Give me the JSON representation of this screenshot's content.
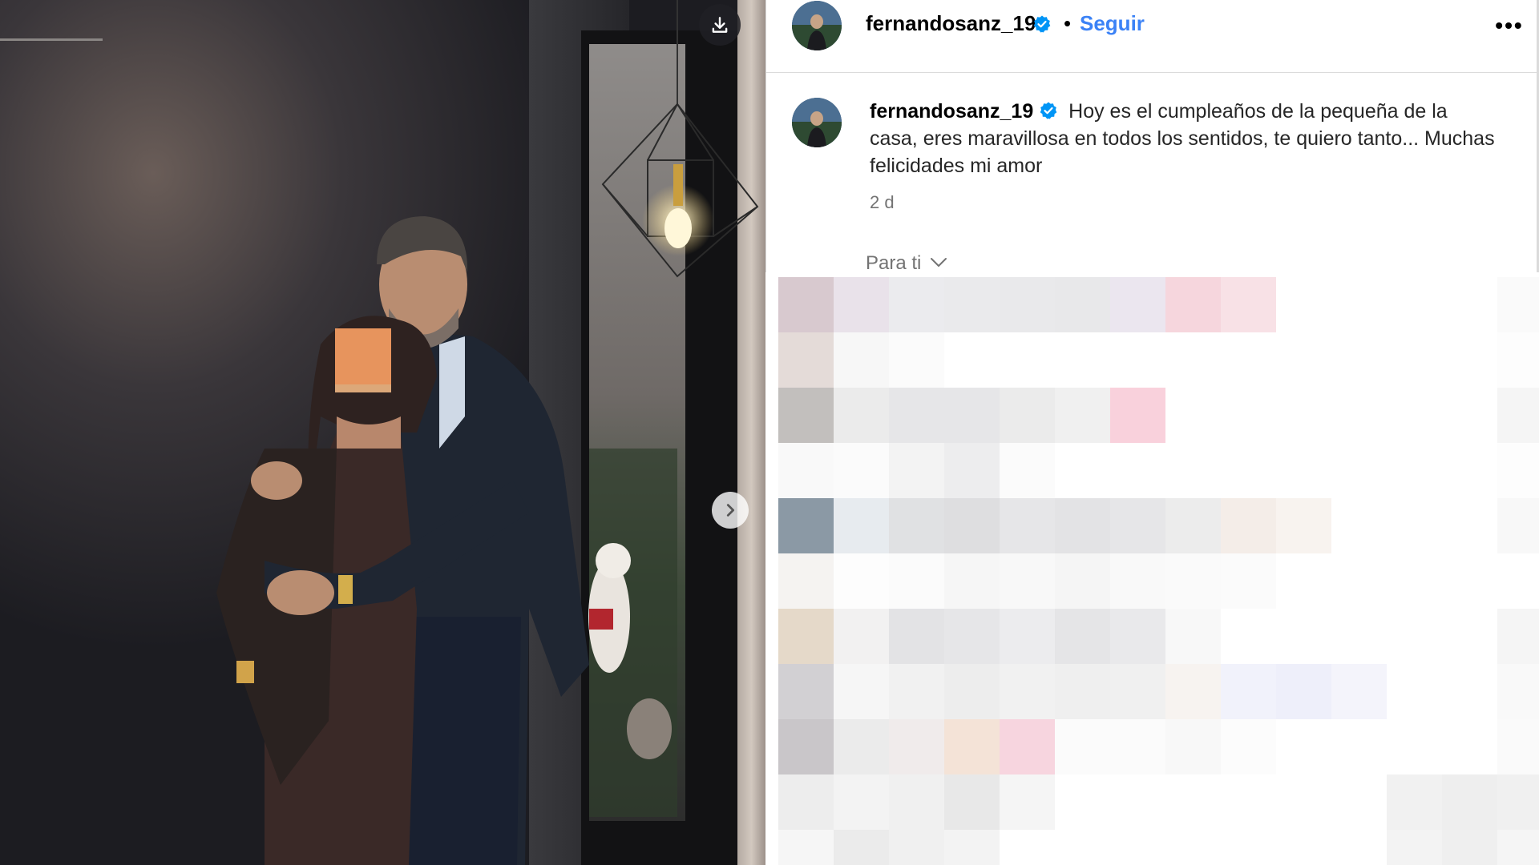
{
  "post": {
    "username": "fernandosanz_19",
    "follow_label": "Seguir",
    "dot_separator": "•",
    "more_label": "•••",
    "caption": "Hoy es el cumpleaños de la pequeña de la casa, eres maravillosa en todos los sentidos, te quiero tanto... Muchas felicidades mi amor",
    "time_ago": "2 d",
    "feed_selector": "Para ti"
  },
  "icons": {
    "download": "download-icon",
    "next": "chevron-right-icon",
    "verified": "verified-badge-icon",
    "more": "more-horizontal-icon",
    "feed_selector": "chevron-down-icon"
  },
  "colors": {
    "accent": "#3b82f6",
    "verified": "#0095f6",
    "divider": "#dbdbdb",
    "muted_text": "#737373"
  },
  "pixel_rows": [
    [
      "#d8c9cf",
      "#e9e2ea",
      "#ebebee",
      "#eaeaec",
      "#e9e9eb",
      "#e8e8ea",
      "#ebe6ef",
      "#f6d6dd",
      "#f8e1e6",
      "#ffffff",
      "#ffffff",
      "#ffffff",
      "#ffffff",
      "#fafafa",
      "#ececec"
    ],
    [
      "#e4dbd8",
      "#f7f7f7",
      "#fbfbfb",
      "#ffffff",
      "#ffffff",
      "#ffffff",
      "#ffffff",
      "#ffffff",
      "#ffffff",
      "#ffffff",
      "#ffffff",
      "#ffffff",
      "#ffffff",
      "#fdfdfd",
      "#f5f5f5"
    ],
    [
      "#c2bfbd",
      "#ebebeb",
      "#e6e6e8",
      "#e6e6e8",
      "#ebebeb",
      "#f0f0f0",
      "#f9d1dc",
      "#ffffff",
      "#ffffff",
      "#ffffff",
      "#ffffff",
      "#ffffff",
      "#ffffff",
      "#f5f5f5",
      "#ececec"
    ],
    [
      "#f9f9f9",
      "#fbfbfb",
      "#f3f3f3",
      "#ededee",
      "#fbfbfb",
      "#ffffff",
      "#ffffff",
      "#ffffff",
      "#ffffff",
      "#ffffff",
      "#ffffff",
      "#ffffff",
      "#ffffff",
      "#fdfdfd",
      "#f7f7f7"
    ],
    [
      "#8b99a5",
      "#e7ebef",
      "#e0e1e3",
      "#dedee0",
      "#e6e6e8",
      "#e3e3e5",
      "#e6e6e8",
      "#ececec",
      "#f4ede8",
      "#f8f3ef",
      "#ffffff",
      "#ffffff",
      "#ffffff",
      "#f8f8f8",
      "#ededed"
    ],
    [
      "#f5f3f1",
      "#fdfdfd",
      "#fbfbfb",
      "#f6f6f6",
      "#f8f8f8",
      "#f5f5f5",
      "#f9f9f9",
      "#fafafa",
      "#fbfbfb",
      "#ffffff",
      "#ffffff",
      "#ffffff",
      "#ffffff",
      "#ffffff",
      "#f7f7f7"
    ],
    [
      "#e5d9c9",
      "#f2f1f1",
      "#e3e3e5",
      "#e6e6e8",
      "#ececee",
      "#e5e5e7",
      "#e9e9eb",
      "#f8f8f8",
      "#ffffff",
      "#ffffff",
      "#ffffff",
      "#ffffff",
      "#ffffff",
      "#f5f5f5",
      "#ebebeb"
    ],
    [
      "#d2d0d3",
      "#f6f6f6",
      "#f1f1f1",
      "#ededed",
      "#f1f1f1",
      "#efefef",
      "#f0f0f0",
      "#f7f3f0",
      "#f1f2fb",
      "#eeeffa",
      "#f4f4fb",
      "#ffffff",
      "#ffffff",
      "#f9f9f9",
      "#efefef"
    ],
    [
      "#c9c6c9",
      "#ebebeb",
      "#f0ebeb",
      "#f4e3d7",
      "#f7d5df",
      "#fbfbfb",
      "#fbfbfb",
      "#f8f8f8",
      "#fcfcfc",
      "#ffffff",
      "#ffffff",
      "#ffffff",
      "#ffffff",
      "#fafafa",
      "#f0f0f0"
    ],
    [
      "#ededed",
      "#f3f3f3",
      "#f0f0f0",
      "#e8e8e8",
      "#f5f5f5",
      "#ffffff",
      "#ffffff",
      "#ffffff",
      "#ffffff",
      "#ffffff",
      "#ffffff",
      "#f1f1f1",
      "#eeeeee",
      "#f0f0f0",
      "#e9e9e9"
    ],
    [
      "#f6f6f6",
      "#ebebeb",
      "#f0f0f0",
      "#f3f3f3",
      "#ffffff",
      "#ffffff",
      "#ffffff",
      "#ffffff",
      "#ffffff",
      "#ffffff",
      "#ffffff",
      "#f3f3f3",
      "#efefef",
      "#f5f5f5",
      "#eeeeee"
    ]
  ]
}
